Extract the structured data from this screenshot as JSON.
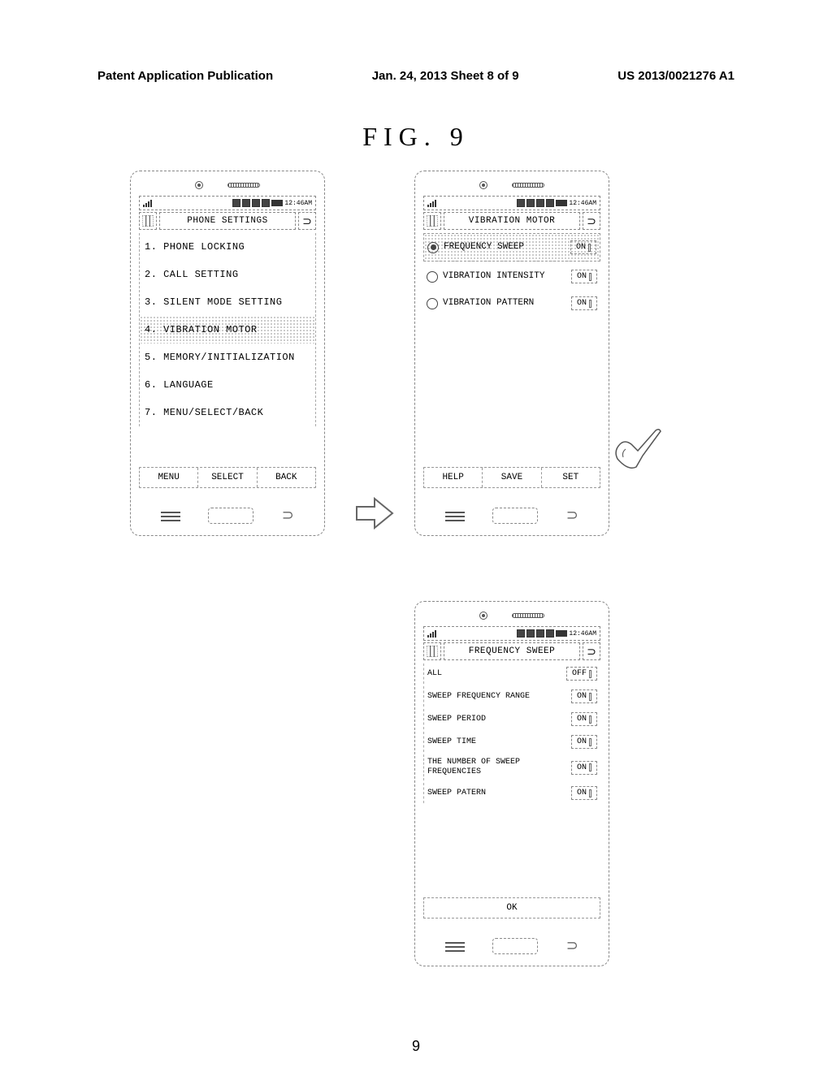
{
  "header": {
    "left": "Patent Application Publication",
    "center": "Jan. 24, 2013  Sheet 8 of 9",
    "right": "US 2013/0021276 A1"
  },
  "figure_label": "FIG. 9",
  "status_time": "12:46AM",
  "phone1": {
    "title": "PHONE SETTINGS",
    "items": [
      "1. PHONE LOCKING",
      "2. CALL SETTING",
      "3. SILENT MODE SETTING",
      "4. VIBRATION MOTOR",
      "5. MEMORY/INITIALIZATION",
      "6. LANGUAGE",
      "7. MENU/SELECT/BACK"
    ],
    "buttons": [
      "MENU",
      "SELECT",
      "BACK"
    ]
  },
  "phone2": {
    "title": "VIBRATION MOTOR",
    "rows": [
      {
        "label": "FREQUENCY SWEEP",
        "value": "ON",
        "checked": true,
        "highlighted": true
      },
      {
        "label": "VIBRATION INTENSITY",
        "value": "ON",
        "checked": false,
        "highlighted": false
      },
      {
        "label": "VIBRATION PATTERN",
        "value": "ON",
        "checked": false,
        "highlighted": false
      }
    ],
    "buttons": [
      "HELP",
      "SAVE",
      "SET"
    ]
  },
  "phone3": {
    "title": "FREQUENCY SWEEP",
    "rows": [
      {
        "label": "ALL",
        "value": "OFF"
      },
      {
        "label": "SWEEP FREQUENCY RANGE",
        "value": "ON"
      },
      {
        "label": "SWEEP PERIOD",
        "value": "ON"
      },
      {
        "label": "SWEEP TIME",
        "value": "ON"
      },
      {
        "label": "THE NUMBER OF SWEEP FREQUENCIES",
        "value": "ON"
      },
      {
        "label": "SWEEP PATERN",
        "value": "ON"
      }
    ],
    "ok": "OK"
  },
  "page_number": "9"
}
